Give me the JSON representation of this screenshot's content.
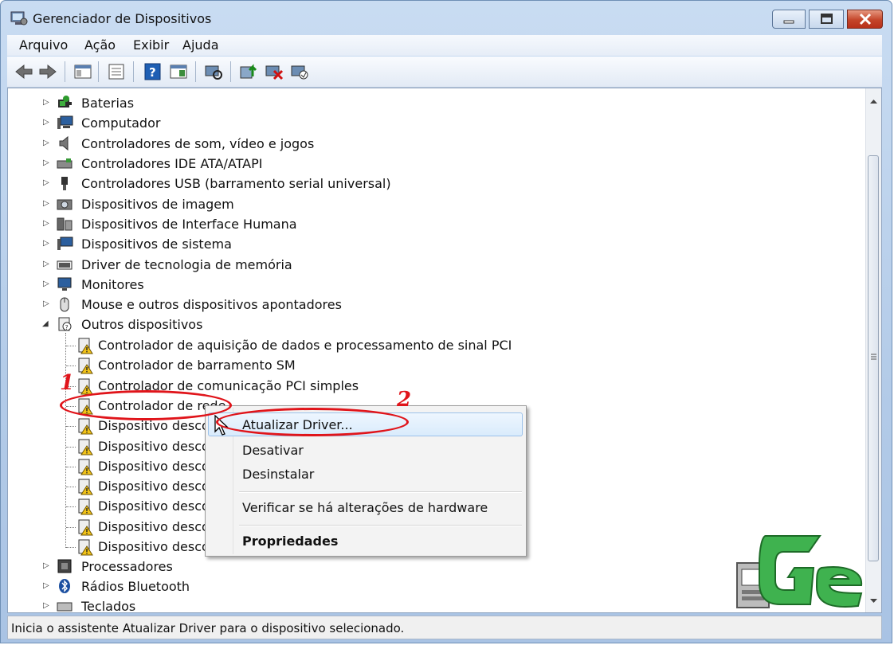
{
  "window": {
    "title": "Gerenciador de Dispositivos"
  },
  "menu": {
    "items": [
      "Arquivo",
      "Ação",
      "Exibir",
      "Ajuda"
    ]
  },
  "toolbar": {
    "buttons": [
      "back-icon",
      "forward-icon",
      "show-hide-console-tree-icon",
      "properties-icon",
      "help-icon",
      "action-pane-icon",
      "scan-hardware-icon",
      "update-driver-icon",
      "uninstall-icon",
      "disable-icon"
    ]
  },
  "tree": {
    "categories": [
      {
        "label": "Baterias",
        "icon": "battery-icon"
      },
      {
        "label": "Computador",
        "icon": "computer-icon"
      },
      {
        "label": "Controladores de som, vídeo e jogos",
        "icon": "speaker-icon"
      },
      {
        "label": "Controladores IDE ATA/ATAPI",
        "icon": "ide-icon"
      },
      {
        "label": "Controladores USB (barramento serial universal)",
        "icon": "usb-icon"
      },
      {
        "label": "Dispositivos de imagem",
        "icon": "camera-icon"
      },
      {
        "label": "Dispositivos de Interface Humana",
        "icon": "hid-icon"
      },
      {
        "label": "Dispositivos de sistema",
        "icon": "system-device-icon"
      },
      {
        "label": "Driver de tecnologia de memória",
        "icon": "memory-icon"
      },
      {
        "label": "Monitores",
        "icon": "monitor-icon"
      },
      {
        "label": "Mouse e outros dispositivos apontadores",
        "icon": "mouse-icon"
      },
      {
        "label": "Outros dispositivos",
        "icon": "unknown-device-icon"
      }
    ],
    "other_devices": [
      "Controlador de aquisição de dados e processamento de sinal PCI",
      "Controlador de barramento SM",
      "Controlador de comunicação PCI simples",
      "Controlador de rede",
      "Dispositivo desco",
      "Dispositivo desco",
      "Dispositivo desco",
      "Dispositivo desco",
      "Dispositivo desco",
      "Dispositivo desco",
      "Dispositivo desco"
    ],
    "after": [
      {
        "label": "Processadores",
        "icon": "processor-icon"
      },
      {
        "label": "Rádios Bluetooth",
        "icon": "bluetooth-icon"
      },
      {
        "label": "Teclados",
        "icon": "keyboard-icon"
      }
    ]
  },
  "context_menu": {
    "update": "Atualizar Driver...",
    "disable": "Desativar",
    "uninstall": "Desinstalar",
    "scan": "Verificar se há alterações de hardware",
    "properties": "Propriedades"
  },
  "annotations": {
    "one": "1",
    "two": "2"
  },
  "status": {
    "text": "Inicia o assistente Atualizar Driver para o dispositivo selecionado."
  },
  "colors": {
    "annotation": "#e0141a",
    "logo_green": "#3fb24f",
    "selection": "#d9ebfc"
  }
}
